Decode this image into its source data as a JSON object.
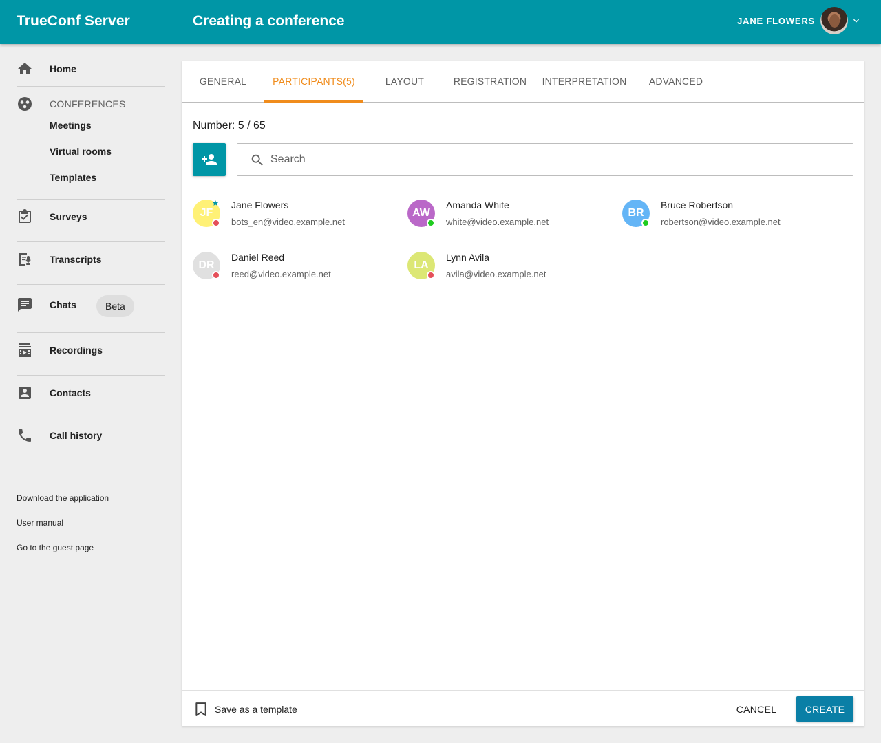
{
  "header": {
    "app_title": "TrueConf Server",
    "page_title": "Creating a conference",
    "user_name": "JANE FLOWERS"
  },
  "sidebar": {
    "home": "Home",
    "conferences_section": "CONFERENCES",
    "meetings": "Meetings",
    "virtual_rooms": "Virtual rooms",
    "templates": "Templates",
    "surveys": "Surveys",
    "transcripts": "Transcripts",
    "chats": "Chats",
    "chats_badge": "Beta",
    "recordings": "Recordings",
    "contacts": "Contacts",
    "call_history": "Call history",
    "footer_links": [
      "Download the application",
      "User manual",
      "Go to the guest page"
    ]
  },
  "tabs": [
    {
      "label": "GENERAL",
      "active": false
    },
    {
      "label": "PARTICIPANTS(5)",
      "active": true
    },
    {
      "label": "LAYOUT",
      "active": false
    },
    {
      "label": "REGISTRATION",
      "active": false
    },
    {
      "label": "INTERPRETATION",
      "active": false
    },
    {
      "label": "ADVANCED",
      "active": false
    }
  ],
  "participants_panel": {
    "count_label": "Number: 5 / 65",
    "search_placeholder": "Search"
  },
  "participants": [
    {
      "initials": "JF",
      "name": "Jane Flowers",
      "email": "bots_en@video.example.net",
      "avatar_color": "#fff176",
      "status": "offline",
      "owner": true
    },
    {
      "initials": "AW",
      "name": "Amanda White",
      "email": "white@video.example.net",
      "avatar_color": "#ba68c8",
      "status": "online",
      "owner": false
    },
    {
      "initials": "BR",
      "name": "Bruce Robertson",
      "email": "robertson@video.example.net",
      "avatar_color": "#64b5f6",
      "status": "online",
      "owner": false
    },
    {
      "initials": "DR",
      "name": "Daniel Reed",
      "email": "reed@video.example.net",
      "avatar_color": "#e0e0e0",
      "status": "offline",
      "owner": false
    },
    {
      "initials": "LA",
      "name": "Lynn Avila",
      "email": "avila@video.example.net",
      "avatar_color": "#dce775",
      "status": "offline",
      "owner": false
    }
  ],
  "status_colors": {
    "online": "#1fcc1f",
    "offline": "#e5505a"
  },
  "footer": {
    "save_template": "Save as a template",
    "cancel": "CANCEL",
    "create": "CREATE"
  },
  "colors": {
    "brand": "#0096a6",
    "accent": "#f08c1c",
    "create_button": "#0a7fa6"
  }
}
